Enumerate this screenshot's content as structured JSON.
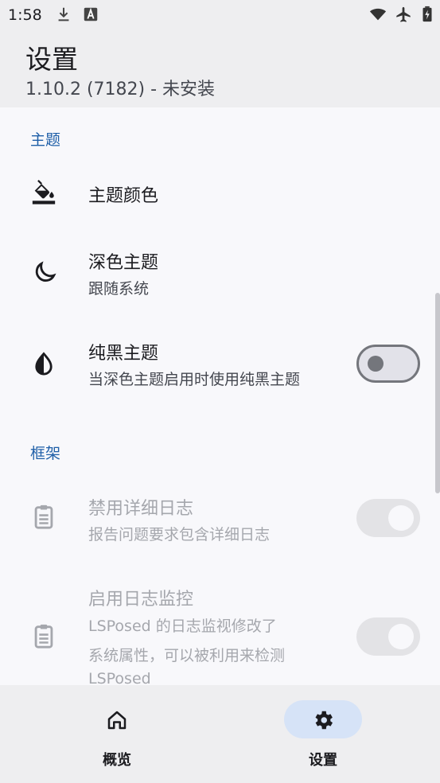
{
  "status_bar": {
    "time": "1:58",
    "icons": [
      "download-icon",
      "font-a-icon",
      "wifi-icon",
      "airplane-icon",
      "battery-charging-icon"
    ]
  },
  "header": {
    "title": "设置",
    "subtitle": "1.10.2 (7182) - 未安装"
  },
  "sections": {
    "theme": {
      "label": "主题",
      "items": [
        {
          "icon": "paint-bucket-icon",
          "title": "主题颜色"
        },
        {
          "icon": "moon-icon",
          "title": "深色主题",
          "subtitle": "跟随系统"
        },
        {
          "icon": "water-drop-icon",
          "title": "纯黑主题",
          "subtitle": "当深色主题启用时使用纯黑主题",
          "toggle": "off"
        }
      ]
    },
    "framework": {
      "label": "框架",
      "items": [
        {
          "icon": "clipboard-icon",
          "title": "禁用详细日志",
          "subtitle": "报告问题要求包含详细日志",
          "toggle": "on-disabled",
          "disabled": true
        },
        {
          "icon": "clipboard-icon",
          "title": "启用日志监控",
          "subtitle_lines": [
            "LSPosed 的日志监视修改了",
            "系统属性，可以被利用来检测",
            "LSPosed"
          ],
          "toggle": "on-disabled",
          "disabled": true
        }
      ]
    }
  },
  "bottom_nav": {
    "items": [
      {
        "icon": "home-icon",
        "label": "概览",
        "active": false
      },
      {
        "icon": "gear-icon",
        "label": "设置",
        "active": true
      }
    ]
  },
  "colors": {
    "accent": "#1f5fa8",
    "active_nav_pill": "#d6e3f7",
    "background": "#f8f8fb",
    "header_background": "#eeeef0"
  }
}
